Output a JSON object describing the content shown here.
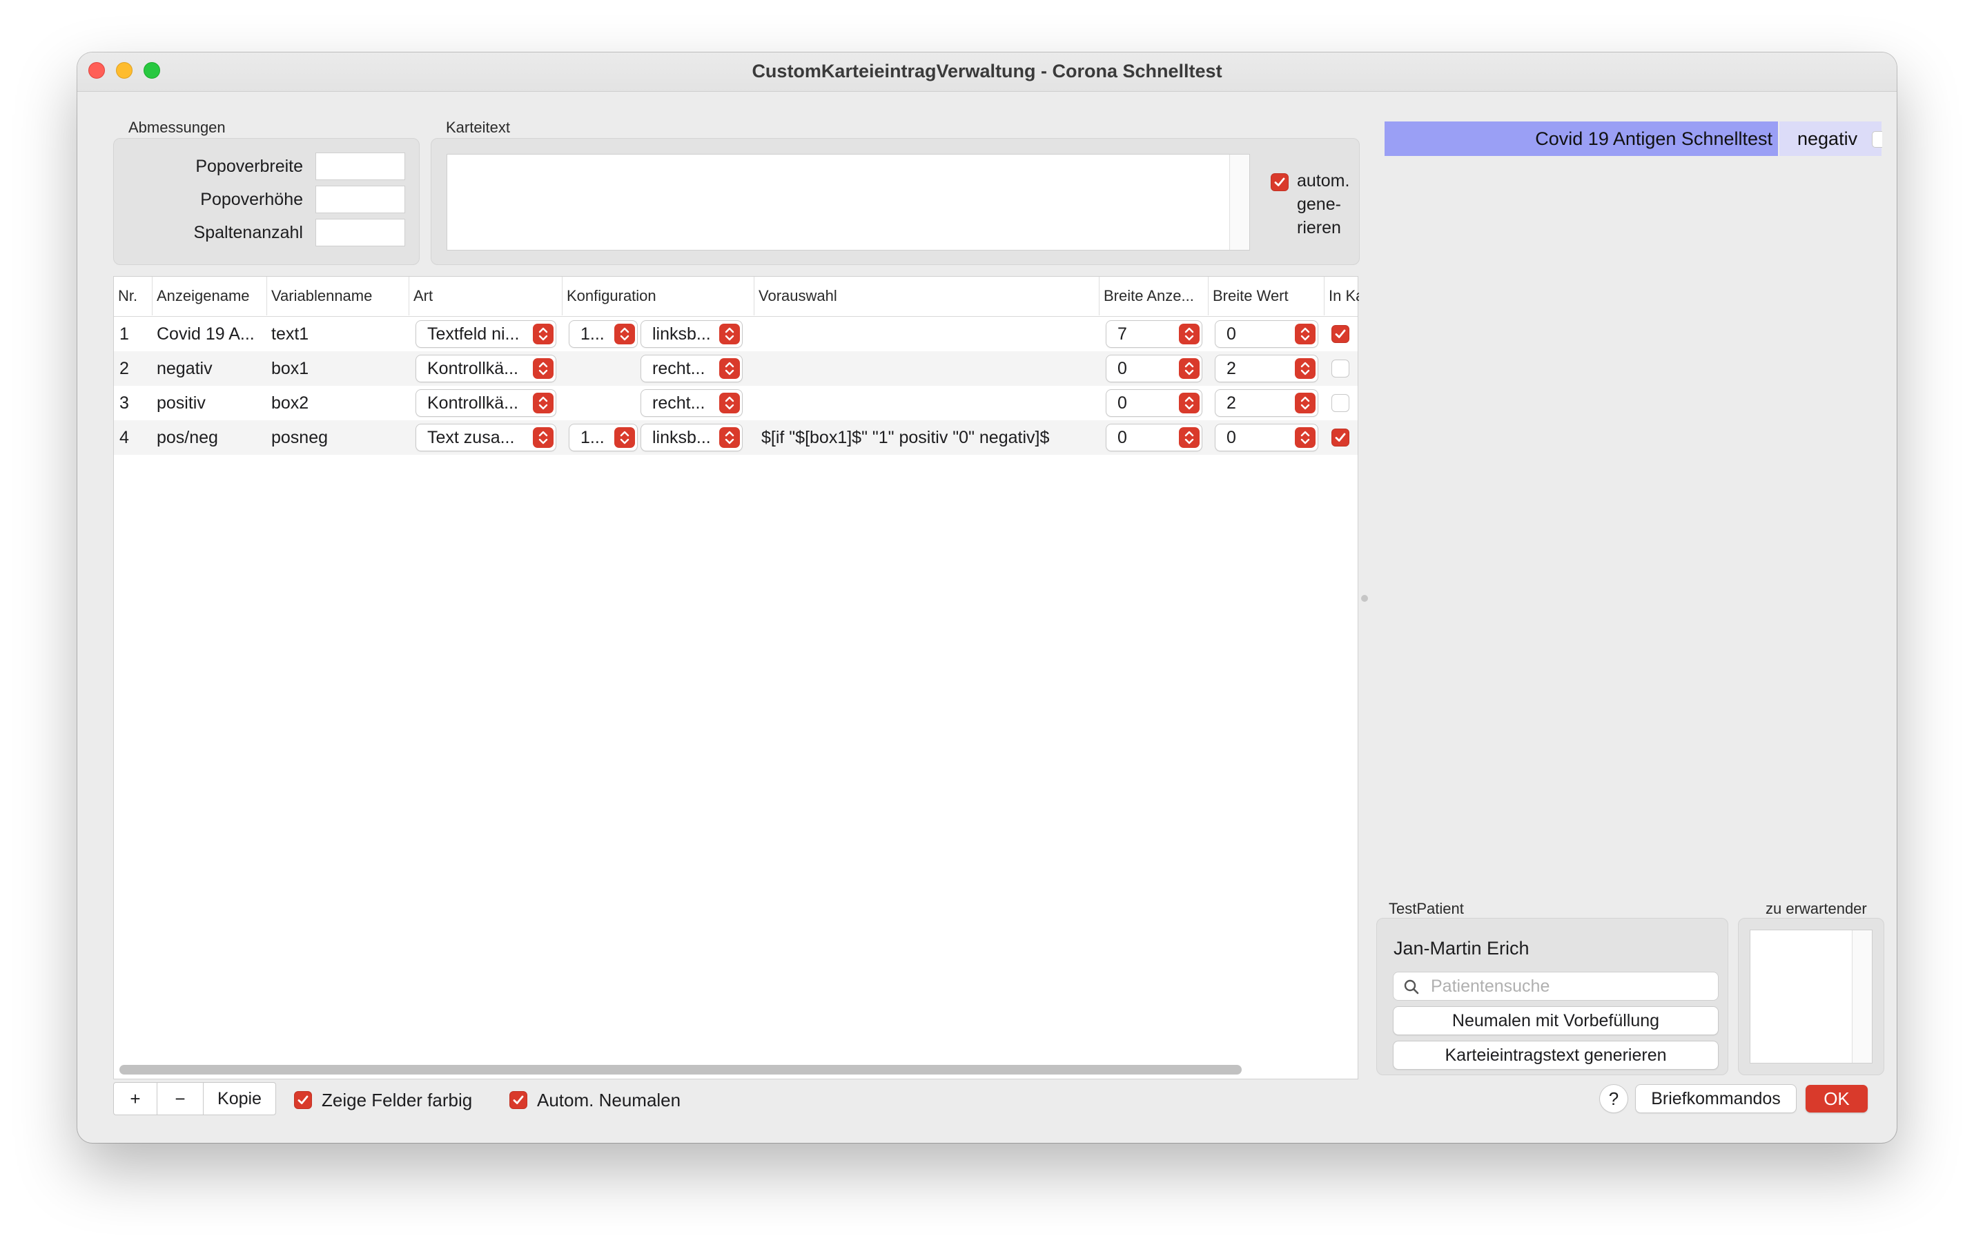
{
  "window": {
    "title": "CustomKarteieintragVerwaltung - Corona Schnelltest"
  },
  "abmessungen": {
    "group_label": "Abmessungen",
    "fields": [
      {
        "label": "Popoverbreite",
        "value": ""
      },
      {
        "label": "Popoverhöhe",
        "value": ""
      },
      {
        "label": "Spaltenanzahl",
        "value": ""
      }
    ]
  },
  "karteitext": {
    "group_label": "Karteitext",
    "value": "",
    "auto_generate": {
      "label_line1": "autom.",
      "label_line2": "gene-",
      "label_line3": "rieren",
      "checked": true
    }
  },
  "table": {
    "columns": [
      "Nr.",
      "Anzeigename",
      "Variablenname",
      "Art",
      "Konfiguration",
      "Vorauswahl",
      "Breite Anze...",
      "Breite Wert",
      "In Ka"
    ],
    "rows": [
      {
        "nr": "1",
        "anzeigename": "Covid 19 A...",
        "variablenname": "text1",
        "art": "Textfeld ni...",
        "konfig1": "1...",
        "konfig2": "linksb...",
        "vorauswahl": "",
        "breite_anzeige": "7",
        "breite_wert": "0",
        "in_kartei": true
      },
      {
        "nr": "2",
        "anzeigename": "negativ",
        "variablenname": "box1",
        "art": "Kontrollkä...",
        "konfig1": "",
        "konfig2": "recht...",
        "vorauswahl": "",
        "breite_anzeige": "0",
        "breite_wert": "2",
        "in_kartei": false
      },
      {
        "nr": "3",
        "anzeigename": "positiv",
        "variablenname": "box2",
        "art": "Kontrollkä...",
        "konfig1": "",
        "konfig2": "recht...",
        "vorauswahl": "",
        "breite_anzeige": "0",
        "breite_wert": "2",
        "in_kartei": false
      },
      {
        "nr": "4",
        "anzeigename": "pos/neg",
        "variablenname": "posneg",
        "art": "Text zusa...",
        "konfig1": "1...",
        "konfig2": "linksb...",
        "vorauswahl": "$[if \"$[box1]$\" \"1\" positiv \"0\" negativ]$",
        "breite_anzeige": "0",
        "breite_wert": "0",
        "in_kartei": true
      }
    ]
  },
  "bottom_bar": {
    "add_label": "+",
    "remove_label": "−",
    "copy_label": "Kopie",
    "colored_fields": {
      "label": "Zeige Felder farbig",
      "checked": true
    },
    "auto_redraw": {
      "label": "Autom. Neumalen",
      "checked": true
    },
    "help_label": "?",
    "letter_commands_label": "Briefkommandos",
    "ok_label": "OK"
  },
  "preview": {
    "cell_label": "Covid 19 Antigen Schnelltest",
    "cell_value": "negativ"
  },
  "patient": {
    "group_label": "TestPatient",
    "name": "Jan-Martin Erich",
    "search_placeholder": "Patientensuche",
    "redraw_button": "Neumalen mit Vorbefüllung",
    "generate_button": "Karteieintragstext generieren"
  },
  "expected": {
    "group_label": "zu erwartender"
  },
  "colors": {
    "accent": "#d93a2b",
    "preview_cell": "#9a9ff5"
  }
}
